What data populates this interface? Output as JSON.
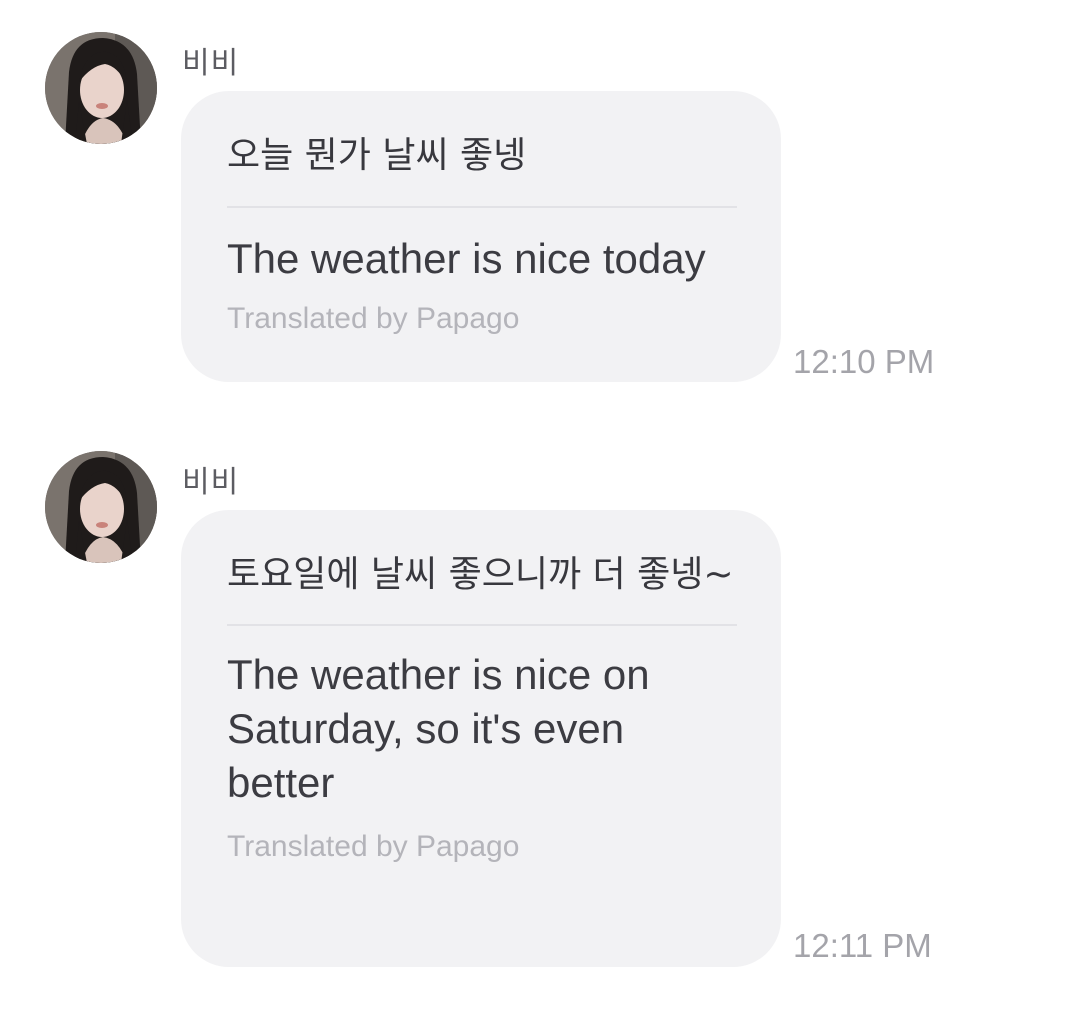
{
  "messages": [
    {
      "sender": "비비",
      "original": "오늘 뭔가 날씨 좋넹",
      "translation": "The weather is nice today",
      "credit": "Translated by Papago",
      "time": "12:10 PM"
    },
    {
      "sender": "비비",
      "original": "토요일에 날씨 좋으니까 더 좋넹~",
      "translation": "The weather is nice on Saturday, so it's even better",
      "credit": "Translated by Papago",
      "time": "12:11 PM"
    }
  ],
  "icons": {
    "avatar": "profile-photo"
  },
  "colors": {
    "bubble": "#f2f2f4",
    "divider": "#e2e2e6",
    "credit_text": "#b4b4ba",
    "timestamp": "#a4a4aa"
  }
}
